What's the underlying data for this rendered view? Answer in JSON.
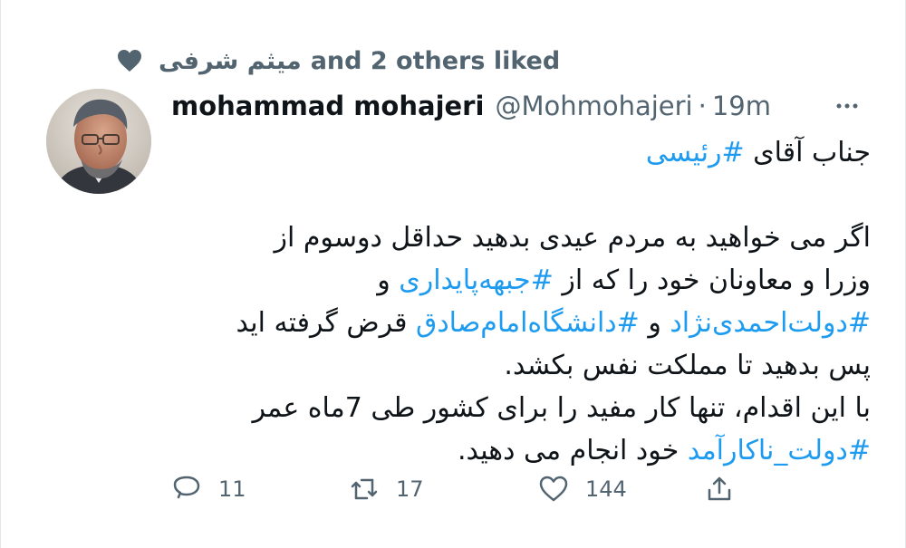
{
  "social_context": {
    "liker": "میثم شرفی",
    "text": "and 2 others liked",
    "icon": "heart-icon",
    "color": "#536471"
  },
  "tweet": {
    "author": {
      "name": "mohammad mohajeri",
      "handle": "@Mohmohajeri",
      "time": "19m",
      "separator": "·"
    },
    "line1_prefix": "جناب آقای ",
    "line1_hashtag": "#رئیسی",
    "line2": "اگر می خواهید به مردم عیدی بدهید حداقل دوسوم از",
    "line3_prefix": "وزرا  و معاونان خود را که از ",
    "line3_hashtag": "#جبهه‌پایداری",
    "line3_suffix": " و",
    "line4_hashtag1": "#دولت‌احمدی‌نژاد",
    "line4_mid": " و ",
    "line4_hashtag2": "#دانشگاه‌امام‌صادق",
    "line4_suffix": " قرض گرفته اید",
    "line5": "پس بدهید تا مملکت نفس بکشد.",
    "line6": " با این اقدام، تنها کار مفید را برای کشور طی 7ماه عمر",
    "line7_hashtag": "#دولت_ناکارآمد",
    "line7_suffix": " خود انجام می دهید."
  },
  "actions": {
    "reply_count": "11",
    "retweet_count": "17",
    "like_count": "144"
  },
  "colors": {
    "accent": "#1d9bf0",
    "secondary_text": "#536471",
    "text": "#0f1419",
    "background": "#ffffff"
  }
}
